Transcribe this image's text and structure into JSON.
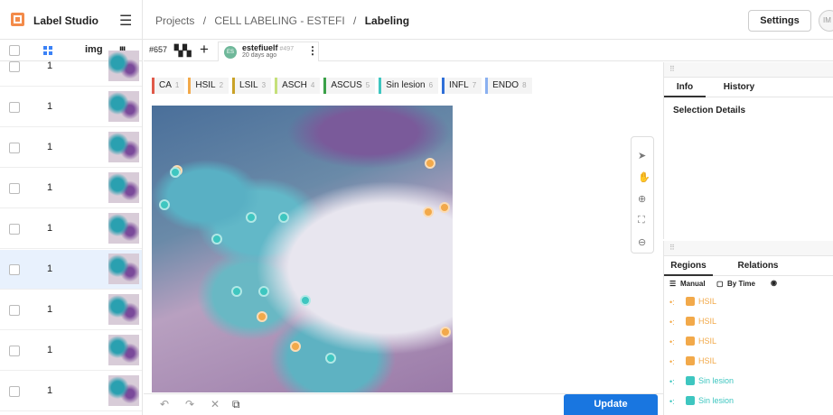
{
  "app": {
    "name": "Label Studio"
  },
  "breadcrumb": {
    "projects": "Projects",
    "project": "CELL LABELING - ESTEFI",
    "current": "Labeling",
    "sep": "/"
  },
  "header": {
    "settings_label": "Settings",
    "avatar_initials": "IM"
  },
  "task_list": {
    "column_img": "img",
    "rows": [
      {
        "value": "1",
        "selected": false
      },
      {
        "value": "1",
        "selected": false
      },
      {
        "value": "1",
        "selected": false
      },
      {
        "value": "1",
        "selected": false
      },
      {
        "value": "1",
        "selected": false
      },
      {
        "value": "1",
        "selected": true
      },
      {
        "value": "1",
        "selected": false
      },
      {
        "value": "1",
        "selected": false
      },
      {
        "value": "1",
        "selected": false
      }
    ]
  },
  "editor": {
    "task_id": "#657",
    "annotation": {
      "initials": "ES",
      "user": "estefiuelf",
      "user_id": "#497",
      "time": "20 days ago"
    }
  },
  "labels": [
    {
      "name": "CA",
      "key": "1",
      "color": "#e05a4a"
    },
    {
      "name": "HSIL",
      "key": "2",
      "color": "#f2a94a"
    },
    {
      "name": "LSIL",
      "key": "3",
      "color": "#c9a227"
    },
    {
      "name": "ASCH",
      "key": "4",
      "color": "#c5e07a"
    },
    {
      "name": "ASCUS",
      "key": "5",
      "color": "#3aa048"
    },
    {
      "name": "Sin lesion",
      "key": "6",
      "color": "#3ec6c0"
    },
    {
      "name": "INFL",
      "key": "7",
      "color": "#2f6fd8"
    },
    {
      "name": "ENDO",
      "key": "8",
      "color": "#8ab0f0"
    }
  ],
  "info_panel": {
    "tab_info": "Info",
    "tab_history": "History",
    "title": "Selection Details"
  },
  "regions_panel": {
    "tab_regions": "Regions",
    "tab_relations": "Relations",
    "sort_manual": "Manual",
    "sort_by_time": "By Time",
    "items": [
      {
        "label": "HSIL",
        "color": "#f2a94a"
      },
      {
        "label": "HSIL",
        "color": "#f2a94a"
      },
      {
        "label": "HSIL",
        "color": "#f2a94a"
      },
      {
        "label": "HSIL",
        "color": "#f2a94a"
      },
      {
        "label": "Sin lesion",
        "color": "#3ec6c0"
      },
      {
        "label": "Sin lesion",
        "color": "#3ec6c0"
      }
    ]
  },
  "actions": {
    "update_label": "Update"
  }
}
